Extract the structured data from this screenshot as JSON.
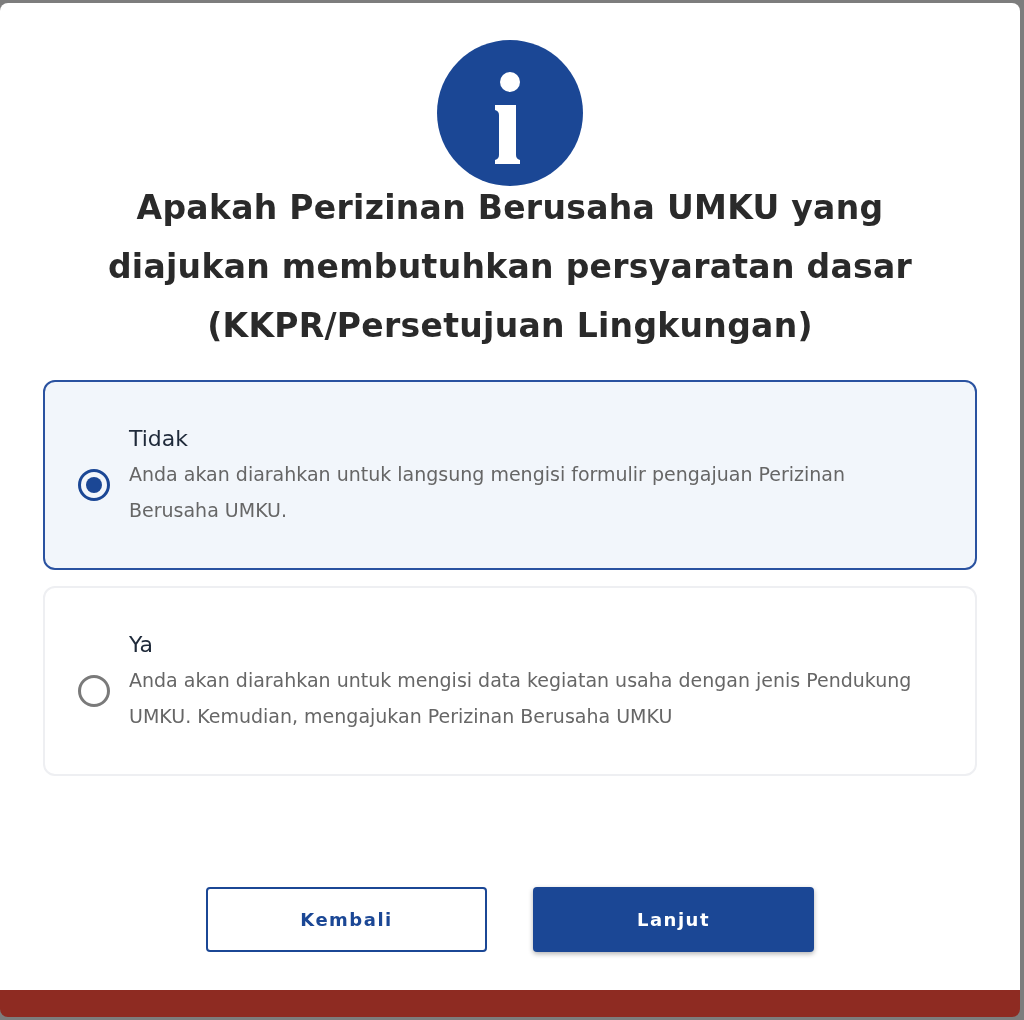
{
  "dialog": {
    "title": "Apakah Perizinan Berusaha UMKU yang diajukan membutuhkan persyaratan dasar (KKPR/Persetujuan Lingkungan)",
    "options": [
      {
        "label": "Tidak",
        "description": "Anda akan diarahkan untuk langsung mengisi formulir pengajuan Perizinan Berusaha UMKU.",
        "selected": true
      },
      {
        "label": "Ya",
        "description": "Anda akan diarahkan untuk mengisi data kegiatan usaha dengan jenis Pendukung UMKU. Kemudian, mengajukan Perizinan Berusaha UMKU",
        "selected": false
      }
    ],
    "buttons": [
      {
        "label": "Kembali",
        "kind": "secondary"
      },
      {
        "label": "Lanjut",
        "kind": "primary"
      }
    ]
  }
}
